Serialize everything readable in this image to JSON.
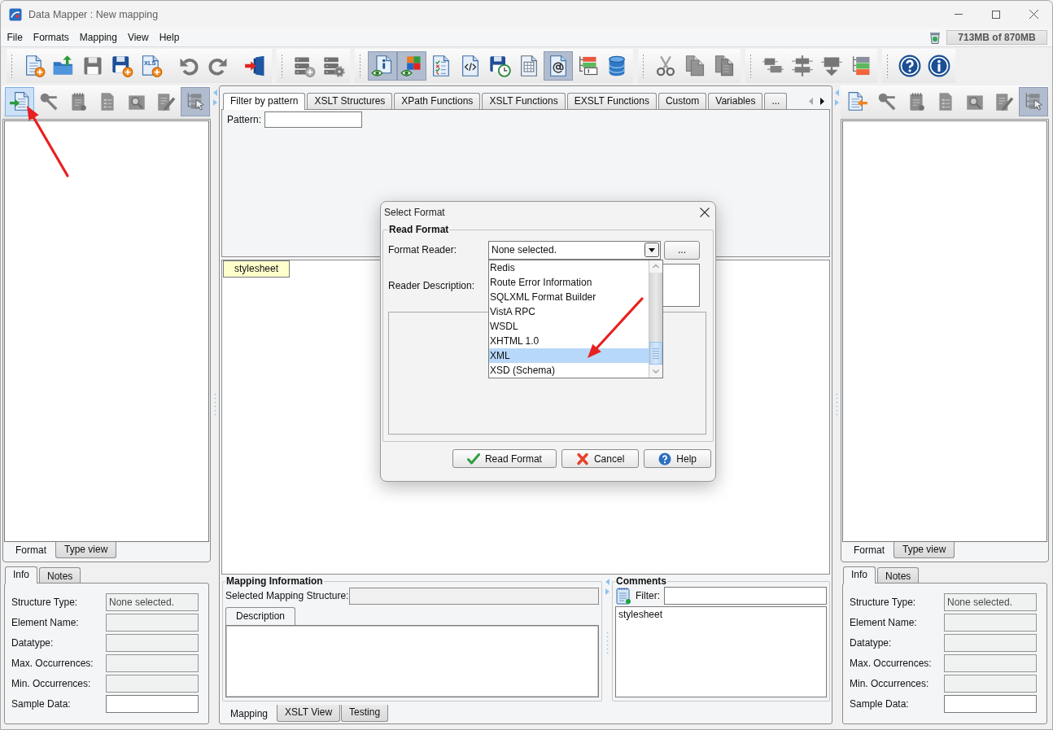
{
  "window": {
    "title": "Data Mapper : New mapping"
  },
  "menu_bar": {
    "items": [
      "File",
      "Formats",
      "Mapping",
      "View",
      "Help"
    ],
    "memory_usage": "713MB of 870MB"
  },
  "toolbar": {
    "groups": [
      [
        {
          "kind": "new",
          "pressed": false,
          "disabled": false
        },
        {
          "kind": "open",
          "pressed": false,
          "disabled": false
        },
        {
          "kind": "save",
          "pressed": false,
          "disabled": true
        },
        {
          "kind": "saveas",
          "pressed": false,
          "disabled": false
        },
        {
          "kind": "xls",
          "text": "XLS",
          "pressed": false,
          "disabled": false
        },
        {
          "kind": "separator"
        },
        {
          "kind": "undo",
          "pressed": false,
          "disabled": true
        },
        {
          "kind": "redo",
          "pressed": false,
          "disabled": true
        },
        {
          "kind": "separator"
        },
        {
          "kind": "exit",
          "pressed": false,
          "disabled": false
        }
      ],
      [
        {
          "kind": "dbadd",
          "pressed": false,
          "disabled": true
        },
        {
          "kind": "dbgear",
          "pressed": false,
          "disabled": true
        }
      ],
      [
        {
          "kind": "infoeye",
          "pressed": true,
          "disabled": false
        },
        {
          "kind": "coloreye",
          "pressed": true,
          "disabled": false
        },
        {
          "kind": "checklist",
          "pressed": false,
          "disabled": false
        },
        {
          "kind": "codedoc",
          "pressed": false,
          "disabled": false
        },
        {
          "kind": "saveclock",
          "pressed": false,
          "disabled": false
        },
        {
          "kind": "tabledoc",
          "pressed": false,
          "disabled": false
        },
        {
          "kind": "atdoc",
          "pressed": true,
          "disabled": false
        },
        {
          "kind": "treetable",
          "pressed": false,
          "disabled": false
        },
        {
          "kind": "database",
          "pressed": false,
          "disabled": false
        }
      ],
      [
        {
          "kind": "cut",
          "pressed": false,
          "disabled": true
        },
        {
          "kind": "copy",
          "pressed": false,
          "disabled": true
        },
        {
          "kind": "paste",
          "pressed": false,
          "disabled": true
        }
      ],
      [
        {
          "kind": "moveup",
          "pressed": false,
          "disabled": true
        },
        {
          "kind": "align",
          "pressed": false,
          "disabled": true
        },
        {
          "kind": "movedown",
          "pressed": false,
          "disabled": true
        },
        {
          "kind": "colortree",
          "pressed": false,
          "disabled": false
        }
      ],
      [
        {
          "kind": "help",
          "pressed": false,
          "disabled": false
        },
        {
          "kind": "about",
          "pressed": false,
          "disabled": false
        }
      ]
    ]
  },
  "left_panel": {
    "tools": [
      {
        "kind": "import",
        "pressed": false,
        "highlighted": true,
        "disabled": false
      },
      {
        "kind": "key",
        "pressed": false,
        "highlighted": false,
        "disabled": true
      },
      {
        "kind": "notepad",
        "pressed": false,
        "highlighted": false,
        "disabled": true
      },
      {
        "kind": "doclist",
        "pressed": false,
        "highlighted": false,
        "disabled": true
      },
      {
        "kind": "search",
        "pressed": false,
        "highlighted": false,
        "disabled": true
      },
      {
        "kind": "edit",
        "pressed": false,
        "highlighted": false,
        "disabled": true
      },
      {
        "kind": "treecursor",
        "pressed": true,
        "highlighted": false,
        "disabled": true
      }
    ],
    "view_tabs": [
      {
        "label": "Format",
        "selected": true
      },
      {
        "label": "Type view",
        "selected": false
      }
    ],
    "info_tabs": [
      {
        "label": "Info",
        "selected": true
      },
      {
        "label": "Notes",
        "selected": false
      }
    ],
    "fields": [
      {
        "label": "Structure Type:",
        "value": "None selected.",
        "disabled": true
      },
      {
        "label": "Element Name:",
        "disabled": true
      },
      {
        "label": "Datatype:",
        "disabled": true
      },
      {
        "label": "Max. Occurrences:",
        "disabled": true
      },
      {
        "label": "Min. Occurrences:",
        "disabled": true
      },
      {
        "label": "Sample Data:",
        "disabled": false
      }
    ]
  },
  "center": {
    "tabs": [
      {
        "label": "Filter by pattern",
        "selected": true
      },
      {
        "label": "XSLT Structures",
        "selected": false
      },
      {
        "label": "XPath Functions",
        "selected": false
      },
      {
        "label": "XSLT Functions",
        "selected": false
      },
      {
        "label": "EXSLT Functions",
        "selected": false
      },
      {
        "label": "Custom",
        "selected": false
      },
      {
        "label": "Variables",
        "selected": false
      },
      {
        "label": "...",
        "selected": false
      }
    ],
    "tab_scroll": {
      "back_disabled": true,
      "forward_disabled": false
    },
    "pattern_label": "Pattern:",
    "canvas_nodes": [
      {
        "label": "stylesheet"
      }
    ],
    "mapping_information": {
      "title": "Mapping Information",
      "structure_label": "Selected Mapping Structure:",
      "tabs": [
        {
          "label": "Description",
          "selected": true
        }
      ]
    },
    "comments": {
      "title": "Comments",
      "filter_label": "Filter:",
      "items": [
        "stylesheet"
      ]
    },
    "bottom_tabs": [
      {
        "label": "Mapping",
        "selected": true
      },
      {
        "label": "XSLT View",
        "selected": false
      },
      {
        "label": "Testing",
        "selected": false
      }
    ]
  },
  "right_panel": {
    "tools": [
      {
        "kind": "export",
        "pressed": false,
        "highlighted": false,
        "disabled": false
      },
      {
        "kind": "key",
        "pressed": false,
        "highlighted": false,
        "disabled": true
      },
      {
        "kind": "notepad",
        "pressed": false,
        "highlighted": false,
        "disabled": true
      },
      {
        "kind": "doclist",
        "pressed": false,
        "highlighted": false,
        "disabled": true
      },
      {
        "kind": "search",
        "pressed": false,
        "highlighted": false,
        "disabled": true
      },
      {
        "kind": "edit",
        "pressed": false,
        "highlighted": false,
        "disabled": true
      },
      {
        "kind": "treecursor",
        "pressed": true,
        "highlighted": false,
        "disabled": true
      }
    ],
    "view_tabs": [
      {
        "label": "Format",
        "selected": true
      },
      {
        "label": "Type view",
        "selected": false
      }
    ],
    "info_tabs": [
      {
        "label": "Info",
        "selected": true
      },
      {
        "label": "Notes",
        "selected": false
      }
    ],
    "fields": [
      {
        "label": "Structure Type:",
        "value": "None selected.",
        "disabled": true
      },
      {
        "label": "Element Name:",
        "disabled": true
      },
      {
        "label": "Datatype:",
        "disabled": true
      },
      {
        "label": "Max. Occurrences:",
        "disabled": true
      },
      {
        "label": "Min. Occurrences:",
        "disabled": true
      },
      {
        "label": "Sample Data:",
        "disabled": false
      }
    ]
  },
  "dialog": {
    "title": "Select Format",
    "group_title": "Read Format",
    "reader_label": "Format Reader:",
    "reader_value": "None selected.",
    "browse_button": "...",
    "description_label": "Reader Description:",
    "dropdown": {
      "items": [
        {
          "label": "Redis",
          "selected": false
        },
        {
          "label": "Route Error Information",
          "selected": false
        },
        {
          "label": "SQLXML Format Builder",
          "selected": false
        },
        {
          "label": "VistA RPC",
          "selected": false
        },
        {
          "label": "WSDL",
          "selected": false
        },
        {
          "label": "XHTML 1.0",
          "selected": false
        },
        {
          "label": "XML",
          "selected": true
        },
        {
          "label": "XSD (Schema)",
          "selected": false
        }
      ]
    },
    "buttons": [
      {
        "kind": "ok",
        "label": "Read Format"
      },
      {
        "kind": "cancel",
        "label": "Cancel"
      },
      {
        "kind": "help",
        "label": "Help"
      }
    ]
  },
  "annotations": [
    {
      "kind": "arrow"
    },
    {
      "kind": "arrow"
    }
  ]
}
